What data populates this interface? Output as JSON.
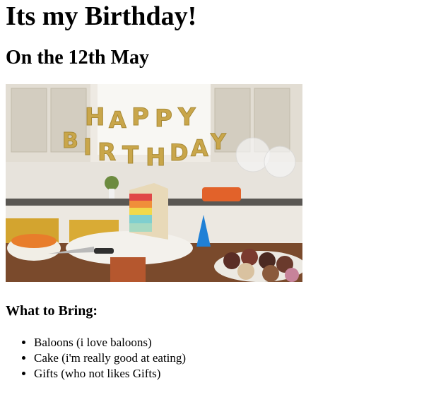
{
  "page": {
    "title": "Its my Birthday!",
    "subtitle": "On the 12th May",
    "image": {
      "icon": "birthday-party-photo",
      "balloons_text": "HAPPY BIRTHDAY",
      "colors": {
        "balloon_gold": "#c9a64a",
        "wall": "#eeeae3",
        "table": "#7a4a2c",
        "cake_blue": "#7fcfcf"
      }
    },
    "bring_heading": "What to Bring:",
    "bring_items": [
      "Baloons (i love baloons)",
      "Cake (i'm really good at eating)",
      "Gifts (who not likes Gifts)"
    ]
  }
}
